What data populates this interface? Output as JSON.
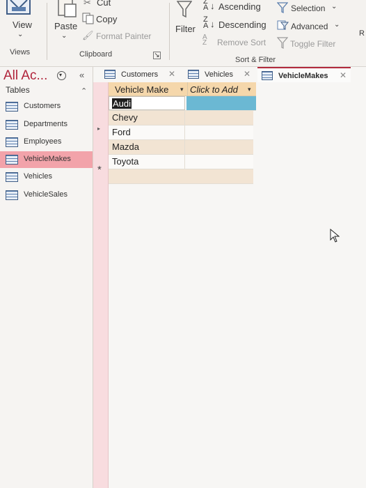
{
  "ribbon": {
    "views": {
      "view_label": "View",
      "group_label": "Views"
    },
    "clipboard": {
      "paste_label": "Paste",
      "cut_label": "Cut",
      "copy_label": "Copy",
      "format_painter_label": "Format Painter",
      "group_label": "Clipboard"
    },
    "sort_filter": {
      "filter_label": "Filter",
      "ascending_label": "Ascending",
      "descending_label": "Descending",
      "remove_sort_label": "Remove Sort",
      "selection_label": "Selection",
      "advanced_label": "Advanced",
      "toggle_filter_label": "Toggle Filter",
      "group_label": "Sort & Filter"
    },
    "next_group_partial": "R"
  },
  "nav": {
    "title": "All Ac...",
    "collapse_glyph": "«",
    "section_label": "Tables",
    "section_toggle_glyph": "⌃",
    "items": [
      {
        "label": "Customers"
      },
      {
        "label": "Departments"
      },
      {
        "label": "Employees"
      },
      {
        "label": "VehicleMakes"
      },
      {
        "label": "Vehicles"
      },
      {
        "label": "VehicleSales"
      }
    ]
  },
  "tabs": [
    {
      "label": "Customers"
    },
    {
      "label": "Vehicles"
    },
    {
      "label": "VehicleMakes"
    }
  ],
  "grid": {
    "columns": [
      "Vehicle Make",
      "Click to Add"
    ],
    "rows": [
      "Audi",
      "Chevy",
      "Ford",
      "Mazda",
      "Toyota"
    ],
    "new_record_glyph": "*",
    "current_glyph": "▸"
  },
  "colors": {
    "accent": "#b0233a",
    "selected_nav": "#f2a3aa",
    "header_bg": "#f5d7ab",
    "highlight_cell": "#6bb8d3"
  }
}
